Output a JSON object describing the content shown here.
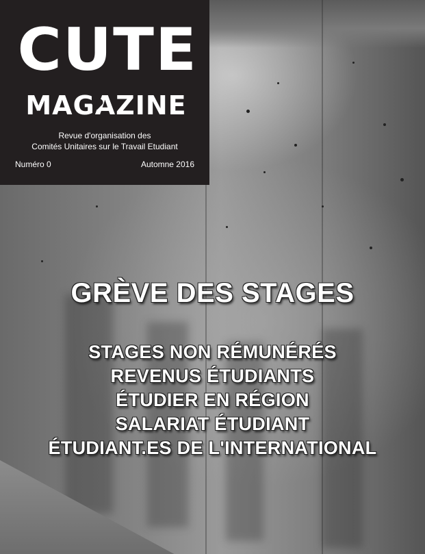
{
  "masthead": {
    "logo_line1": "CUTE",
    "logo_line2": "MAGAZINE",
    "subtitle_line1": "Revue d'organisation des",
    "subtitle_line2": "Comités Unitaires sur le Travail Etudiant",
    "issue": "Numéro 0",
    "season": "Automne 2016",
    "background_color": "#231f20"
  },
  "cover": {
    "headline": "GRÈVE DES STAGES",
    "topics": [
      "STAGES NON RÉMUNÉRÉS",
      "REVENUS ÉTUDIANTS",
      "ÉTUDIER EN RÉGION",
      "SALARIAT ÉTUDIANT",
      "ÉTUDIANT.ES DE L'INTERNATIONAL"
    ]
  }
}
